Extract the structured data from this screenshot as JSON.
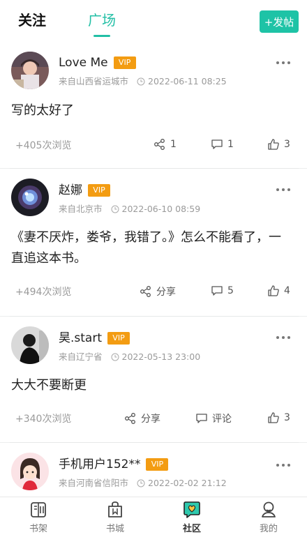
{
  "header": {
    "tabs": [
      {
        "label": "关注",
        "active": false
      },
      {
        "label": "广场",
        "active": true
      }
    ],
    "post_button_label": "+发帖"
  },
  "colors": {
    "accent": "#22bfa5",
    "vip_badge": "#f39c12"
  },
  "posts": [
    {
      "username": "Love Me",
      "vip": "VIP",
      "location": "来自山西省运城市",
      "time": "2022-06-11 08:25",
      "content": "写的太好了",
      "views": "+405次浏览",
      "share": "1",
      "comments": "1",
      "likes": "3"
    },
    {
      "username": "赵娜",
      "vip": "VIP",
      "location": "来自北京市",
      "time": "2022-06-10 08:59",
      "content": "《妻不厌炸，娄爷，我错了。》怎么不能看了，一直追这本书。",
      "views": "+494次浏览",
      "share": "分享",
      "comments": "5",
      "likes": "4"
    },
    {
      "username": "昊.start",
      "vip": "VIP",
      "location": "来自辽宁省",
      "time": "2022-05-13 23:00",
      "content": "大大不要断更",
      "views": "+340次浏览",
      "share": "分享",
      "comments": "评论",
      "likes": "3"
    },
    {
      "username": "手机用户152**",
      "vip": "VIP",
      "location": "来自河南省信阳市",
      "time": "2022-02-02 21:12"
    }
  ],
  "bottom_nav": [
    {
      "label": "书架",
      "icon": "bookshelf-icon",
      "active": false
    },
    {
      "label": "书城",
      "icon": "bookstore-icon",
      "active": false
    },
    {
      "label": "社区",
      "icon": "community-icon",
      "active": true
    },
    {
      "label": "我的",
      "icon": "profile-icon",
      "active": false
    }
  ]
}
